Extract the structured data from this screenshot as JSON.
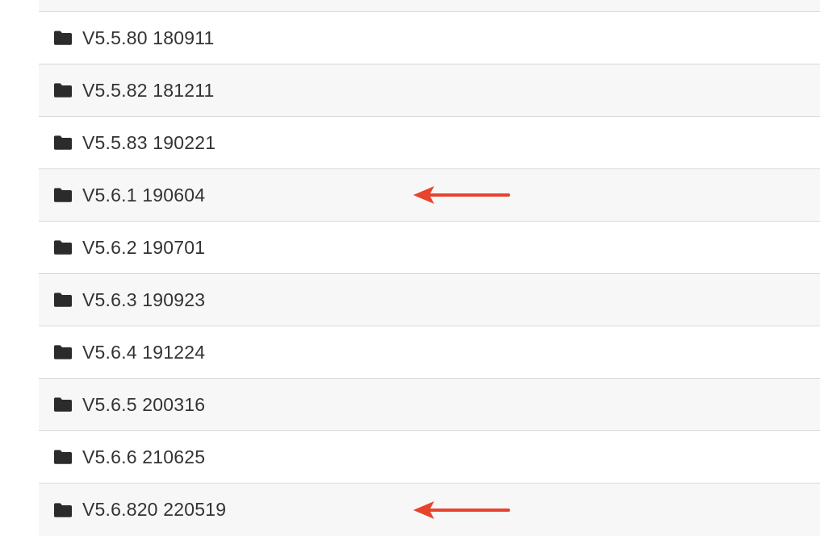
{
  "folders": [
    {
      "label": "V5.5.80 180911",
      "highlighted": false
    },
    {
      "label": "V5.5.82 181211",
      "highlighted": false
    },
    {
      "label": "V5.5.83 190221",
      "highlighted": false
    },
    {
      "label": "V5.6.1 190604",
      "highlighted": true
    },
    {
      "label": "V5.6.2 190701",
      "highlighted": false
    },
    {
      "label": "V5.6.3 190923",
      "highlighted": false
    },
    {
      "label": "V5.6.4 191224",
      "highlighted": false
    },
    {
      "label": "V5.6.5 200316",
      "highlighted": false
    },
    {
      "label": "V5.6.6 210625",
      "highlighted": false
    },
    {
      "label": "V5.6.820 220519",
      "highlighted": true
    }
  ],
  "icons": {
    "folder": "folder-icon",
    "annotation": "red-arrow-icon"
  },
  "colors": {
    "row_alt_bg": "#f7f7f7",
    "divider": "#d9d9d9",
    "text": "#333333",
    "icon": "#2b2b2b",
    "arrow": "#e8432d"
  }
}
